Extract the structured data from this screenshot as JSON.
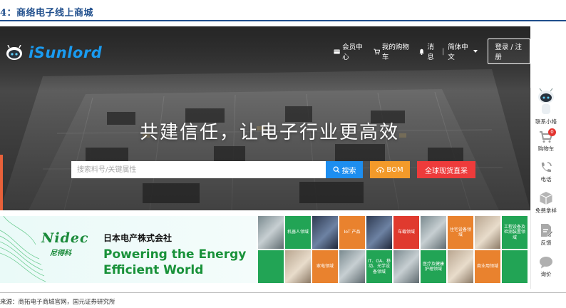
{
  "caption": "4：商络电子线上商城",
  "logo": {
    "text": "iSunlord",
    "color": "#1a9bf0"
  },
  "nav": {
    "member_center": "会员中心",
    "my_cart": "我的购物车",
    "messages": "消息",
    "separator": "|",
    "language": "简体中文",
    "login": "登录 / 注册"
  },
  "hero": {
    "slogan": "共建信任，让电子行业更高效",
    "search_placeholder": "搜索料号/关键属性",
    "search_button": "搜索",
    "bom_button": "BOM",
    "spot_button": "全球现货直采",
    "colors": {
      "search": "#1d8ef0",
      "bom": "#f39a2a",
      "spot": "#ee3b3b"
    }
  },
  "banner": {
    "brand_logo": "Nidec",
    "brand_cn": "尼得科",
    "company_jp": "日本电产株式会社",
    "tagline_1": "Powering the Energy",
    "tagline_2": "Efficient World",
    "tiles": [
      {
        "label": "",
        "style": "img"
      },
      {
        "label": "机器人领域",
        "style": "green"
      },
      {
        "label": "",
        "style": "img2"
      },
      {
        "label": "IoT 产品",
        "style": "orange"
      },
      {
        "label": "",
        "style": "img2"
      },
      {
        "label": "车载领域",
        "style": "red"
      },
      {
        "label": "",
        "style": "img"
      },
      {
        "label": "住宅设备领域",
        "style": "orange"
      },
      {
        "label": "",
        "style": "img3"
      },
      {
        "label": "工程设备及检测装置领域",
        "style": "green"
      },
      {
        "label": "",
        "style": "green"
      },
      {
        "label": "",
        "style": "img3"
      },
      {
        "label": "家电领域",
        "style": "orange"
      },
      {
        "label": "",
        "style": "img"
      },
      {
        "label": "IT、OA、移动、光学设备领域",
        "style": "green"
      },
      {
        "label": "",
        "style": "img"
      },
      {
        "label": "医疗及健康护理领域",
        "style": "green"
      },
      {
        "label": "",
        "style": "img3"
      },
      {
        "label": "商业用领域",
        "style": "orange"
      },
      {
        "label": "",
        "style": "green"
      }
    ],
    "tile_colors": {
      "green": "#22a455",
      "orange": "#e9822e",
      "red": "#e03a2e"
    }
  },
  "sidebar": {
    "contact": "联系小络",
    "cart": "购物车",
    "cart_count": "0",
    "phone": "电话",
    "sample": "免费拿样",
    "feedback": "反馈",
    "inquiry": "询价"
  },
  "source": "来源：商拓电子商城官网，国元证券研究所"
}
